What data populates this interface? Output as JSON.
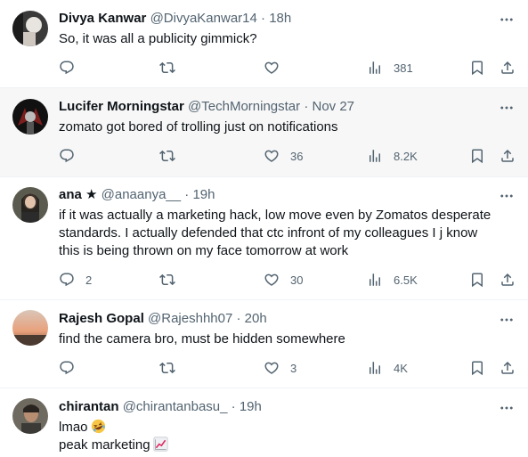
{
  "tweets": [
    {
      "name": "Divya Kanwar",
      "handle": "@DivyaKanwar14",
      "sep": "·",
      "time": "18h",
      "lines": [
        "So, it was all a publicity gimmick?"
      ],
      "counts": {
        "reply": "",
        "retweet": "",
        "like": "",
        "views": "381"
      }
    },
    {
      "name": "Lucifer Morningstar",
      "handle": "@TechMorningstar",
      "sep": "·",
      "time": "Nov 27",
      "lines": [
        "zomato got bored of trolling just on notifications"
      ],
      "counts": {
        "reply": "",
        "retweet": "",
        "like": "36",
        "views": "8.2K"
      }
    },
    {
      "name": "ana ★",
      "handle": "@anaanya__",
      "sep": "·",
      "time": "19h",
      "lines": [
        "if it was actually a marketing hack, low move even by Zomatos desperate",
        "standards. I actually defended that ctc infront of my colleagues I j know",
        "this is being thrown on my face tomorrow at work"
      ],
      "counts": {
        "reply": "2",
        "retweet": "",
        "like": "30",
        "views": "6.5K"
      }
    },
    {
      "name": "Rajesh Gopal",
      "handle": "@Rajeshhh07",
      "sep": "·",
      "time": "20h",
      "lines": [
        "find the camera bro, must be hidden somewhere"
      ],
      "counts": {
        "reply": "",
        "retweet": "",
        "like": "3",
        "views": "4K"
      }
    },
    {
      "name": "chirantan",
      "handle": "@chirantanbasu_",
      "sep": "·",
      "time": "19h",
      "lines": [
        "lmao",
        "peak marketing"
      ],
      "emojis": [
        "rolling-laughing-emoji",
        "chart-increasing-emoji"
      ]
    }
  ],
  "icons": {
    "reply": "reply-icon",
    "retweet": "retweet-icon",
    "like": "like-icon",
    "views": "views-icon",
    "bookmark": "bookmark-icon",
    "share": "share-icon",
    "more": "more-icon"
  },
  "colors": {
    "text": "#0f1419",
    "secondary": "#536471",
    "hover_bg": "#f7f7f7",
    "divider": "#eff3f4"
  }
}
